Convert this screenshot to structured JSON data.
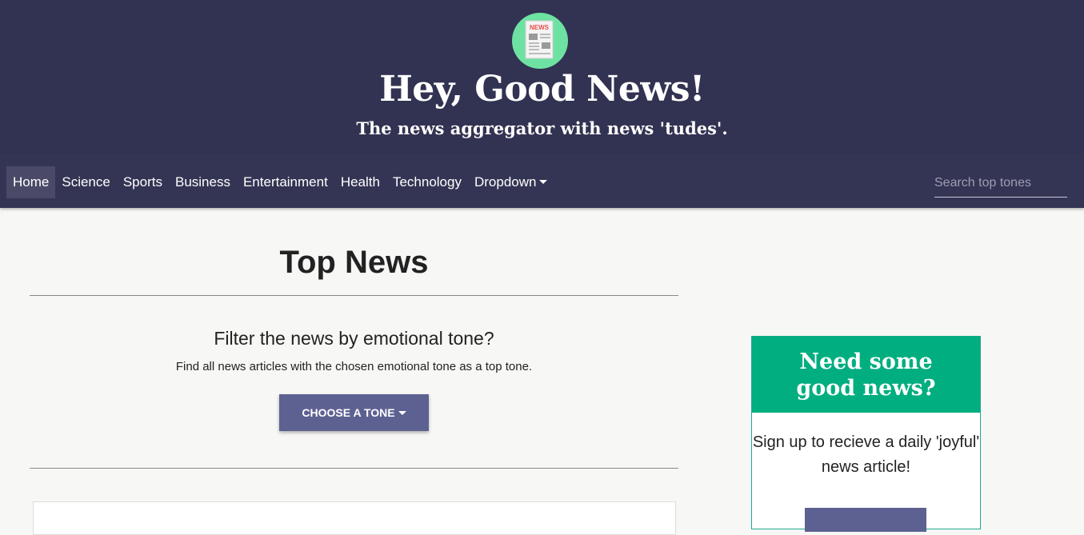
{
  "header": {
    "logo_icon": "news-paper-icon",
    "logo_text": "NEWS",
    "title": "Hey, Good News!",
    "tagline": "The news aggregator with news 'tudes'."
  },
  "nav": {
    "items": [
      {
        "label": "Home",
        "active": true
      },
      {
        "label": "Science"
      },
      {
        "label": "Sports"
      },
      {
        "label": "Business"
      },
      {
        "label": "Entertainment"
      },
      {
        "label": "Health"
      },
      {
        "label": "Technology"
      },
      {
        "label": "Dropdown"
      }
    ],
    "search_placeholder": "Search top tones"
  },
  "main": {
    "title": "Top News",
    "filter_heading": "Filter the news by emotional tone?",
    "filter_description": "Find all news articles with the chosen emotional tone as a top tone.",
    "tone_button": "CHOOSE A TONE"
  },
  "promo": {
    "heading": "Need some good news?",
    "text": "Sign up to recieve a daily 'joyful' news article!"
  },
  "colors": {
    "header_bg": "#323252",
    "nav_bg": "#343454",
    "accent_green": "#00ae80",
    "button_purple": "#5d6191"
  }
}
